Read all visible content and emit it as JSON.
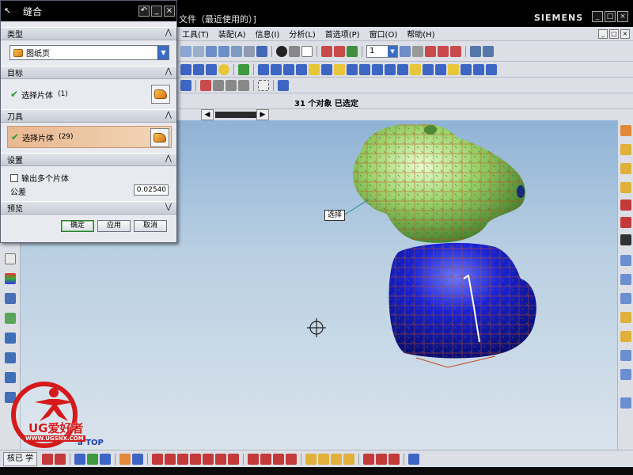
{
  "titlebar": {
    "title": "文件（最近使用的）]",
    "brand": "SIEMENS",
    "buttons": [
      "_",
      "□",
      "×"
    ]
  },
  "menubar": {
    "items": [
      "工具(T)",
      "装配(A)",
      "信息(I)",
      "分析(L)",
      "首选项(P)",
      "窗口(O)",
      "帮助(H)"
    ],
    "mdi_buttons": [
      "_",
      "□",
      "×"
    ]
  },
  "toolbar": {
    "layer_value": "1"
  },
  "status": {
    "message": "31 个对象 已选定"
  },
  "dialog": {
    "title": "缝合",
    "title_buttons": [
      "↶",
      "_",
      "×"
    ],
    "sections": {
      "type": {
        "header": "类型",
        "selected": "图纸页"
      },
      "target": {
        "header": "目标",
        "label": "选择片体",
        "count": "(1)"
      },
      "tool": {
        "header": "刀具",
        "label": "选择片体",
        "count": "(29)"
      },
      "settings": {
        "header": "设置",
        "output_multiple": "输出多个片体",
        "tolerance_label": "公差",
        "tolerance_value": "0.02540"
      },
      "preview": {
        "header": "预览"
      }
    },
    "buttons": {
      "ok": "确定",
      "apply": "应用",
      "cancel": "取消"
    }
  },
  "graphics": {
    "tag_select": "选择",
    "view_label": "a TOP"
  },
  "bottombar": {
    "doc_tab": "核已 学"
  },
  "logo": {
    "name": "UG爱好者",
    "url": "WWW.UGSNX.COM"
  },
  "colors": {
    "sheet_green": "#9bd26a",
    "sheet_blue": "#1a22d8",
    "accent_blue": "#3a6cc4",
    "logo_red": "#d41a1a"
  }
}
